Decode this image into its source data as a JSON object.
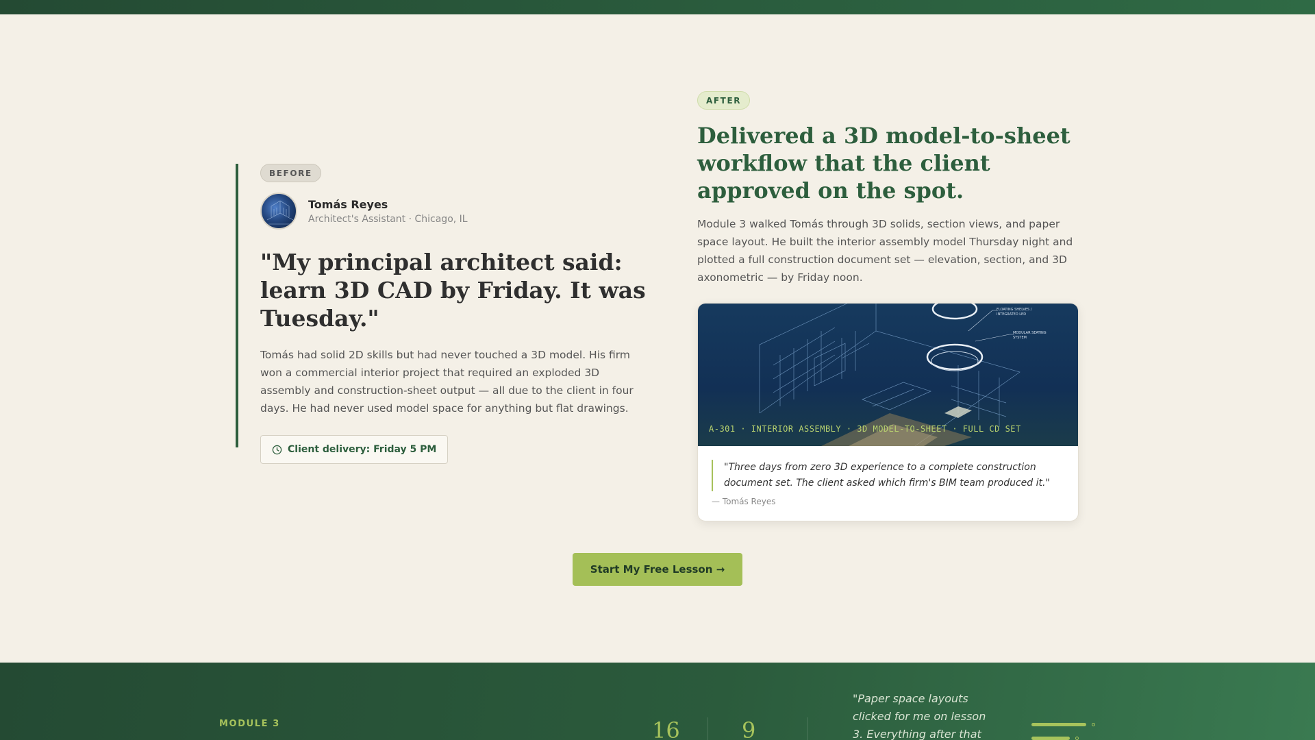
{
  "before": {
    "badge": "BEFORE",
    "person": {
      "name": "Tomás Reyes",
      "role": "Architect's Assistant · Chicago, IL"
    },
    "quote": "\"My principal architect said: learn 3D CAD by Friday. It was Tuesday.\"",
    "body": "Tomás had solid 2D skills but had never touched a 3D model. His firm won a commercial interior project that required an exploded 3D assembly and construction-sheet output — all due to the client in four days. He had never used model space for anything but flat drawings.",
    "deadline": "Client delivery: Friday 5 PM"
  },
  "after": {
    "badge": "AFTER",
    "title": "Delivered a 3D model-to-sheet workflow that the client approved on the spot.",
    "body": "Module 3 walked Tomás through 3D solids, section views, and paper space layout. He built the interior assembly model Thursday night and plotted a full construction document set — elevation, section, and 3D axonometric — by Friday noon.",
    "card": {
      "caption": "A-301 · INTERIOR ASSEMBLY · 3D MODEL-TO-SHEET · FULL CD SET",
      "annotation_1": "FLOATING SHELVES / INTEGRATED LED",
      "annotation_2": "MODULAR SEATING SYSTEM",
      "quote": "\"Three days from zero 3D experience to a complete construction document set. The client asked which firm's BIM team produced it.\"",
      "author": "— Tomás Reyes"
    }
  },
  "cta": {
    "label": "Start My Free Lesson →"
  },
  "band": {
    "label": "MODULE 3",
    "stats": [
      "16",
      "9"
    ],
    "quote": "\"Paper space layouts clicked for me on lesson 3. Everything after that"
  },
  "colors": {
    "accent": "#a4bf57",
    "brand_green": "#2d5e3d",
    "background": "#f4f0e7"
  }
}
